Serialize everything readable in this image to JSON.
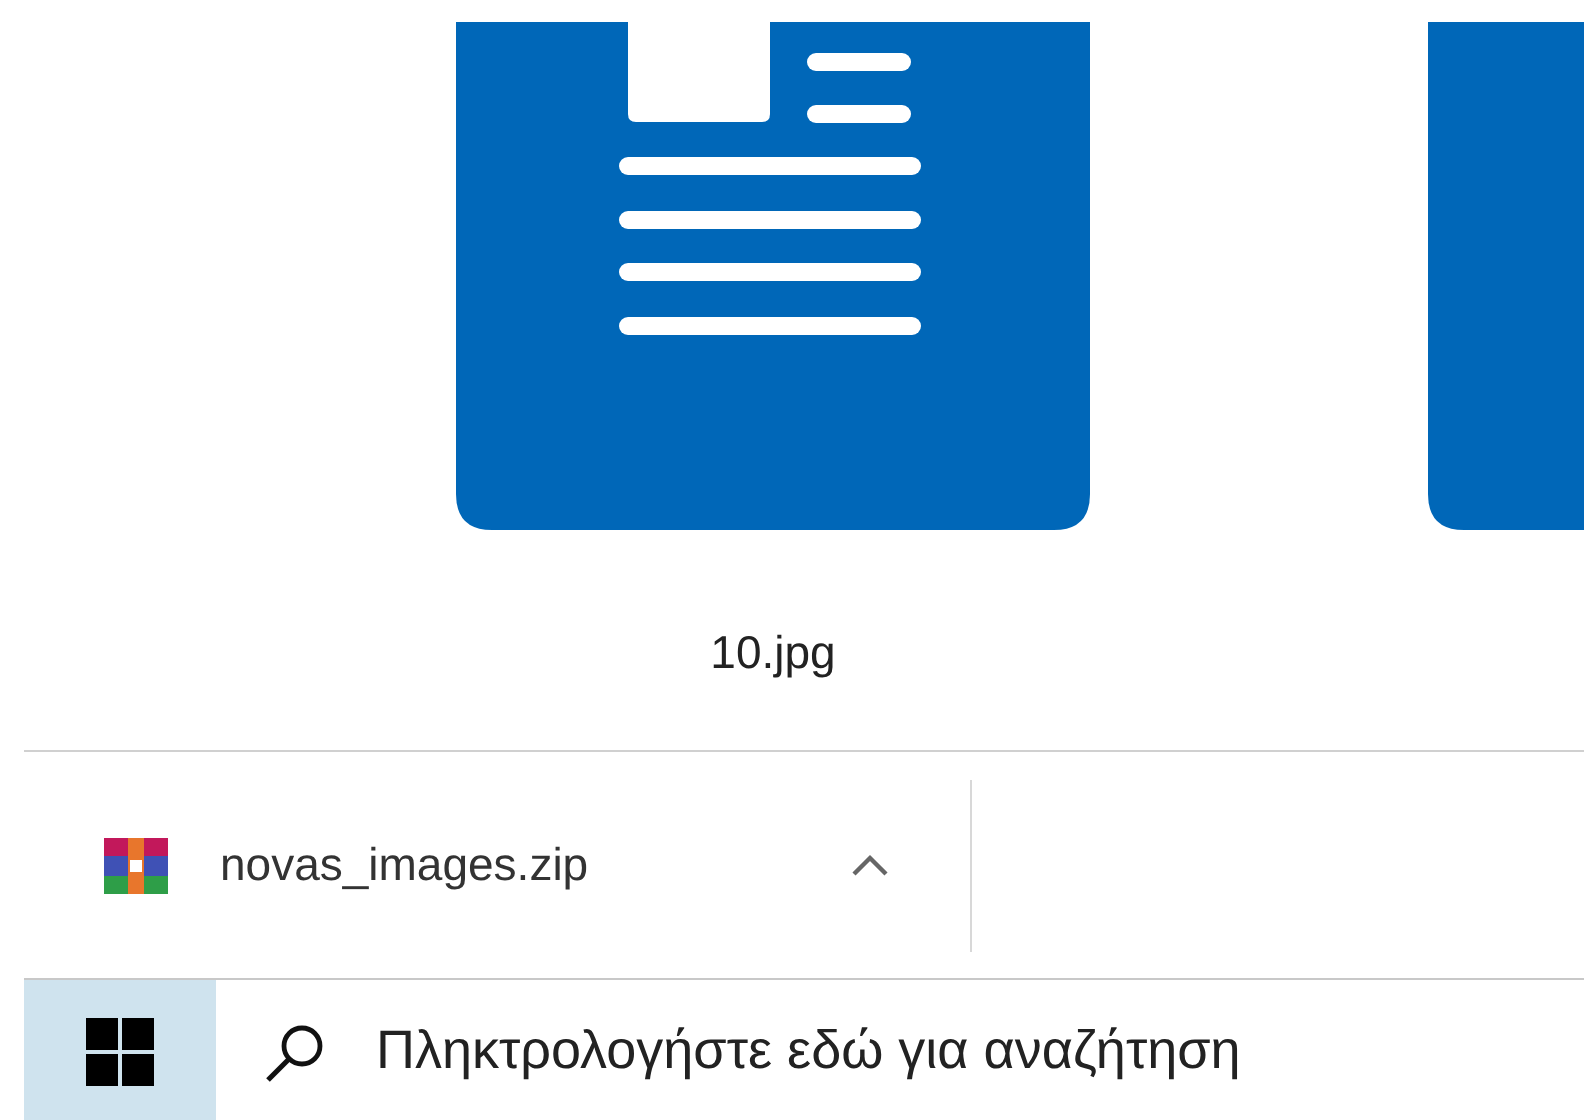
{
  "files": [
    {
      "kind": "document",
      "label": "10.jpg"
    },
    {
      "kind": "document"
    }
  ],
  "downloads": [
    {
      "kind": "archive",
      "filename": "novas_images.zip"
    }
  ],
  "taskbar": {
    "search": {
      "placeholder": "Πληκτρολογήστε εδώ για αναζήτηση"
    }
  }
}
